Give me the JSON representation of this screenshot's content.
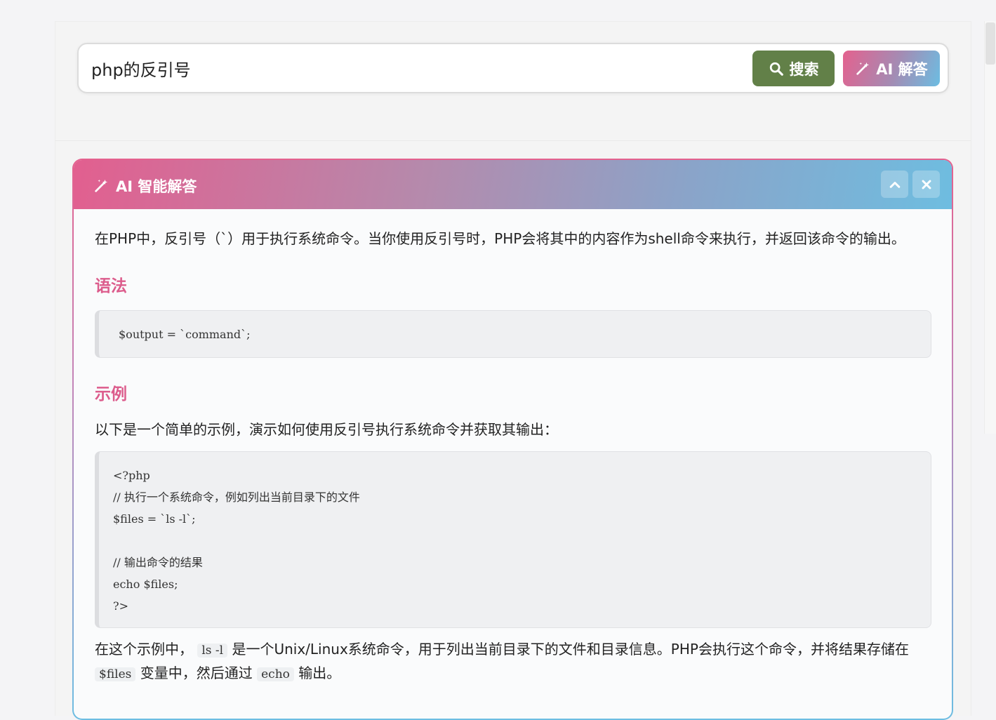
{
  "search": {
    "query": "php的反引号",
    "search_label": "搜索",
    "ai_label": "AI 解答"
  },
  "ai_panel": {
    "title": "AI 智能解答",
    "intro": "在PHP中，反引号（`）用于执行系统命令。当你使用反引号时，PHP会将其中的内容作为shell命令来执行，并返回该命令的输出。",
    "syntax_heading": "语法",
    "syntax_code": "$output = `command`;",
    "example_heading": "示例",
    "example_intro": "以下是一个简单的示例，演示如何使用反引号执行系统命令并获取其输出：",
    "example_code": "<?php\n// 执行一个系统命令，例如列出当前目录下的文件\n$files = `ls -l`;\n\n// 输出命令的结果\necho $files;\n?>",
    "explain_part1": "在这个示例中，",
    "explain_code1": "ls -l",
    "explain_part2": "是一个Unix/Linux系统命令，用于列出当前目录下的文件和目录信息。PHP会执行这个命令，并将结果存储在",
    "explain_code2": "$files",
    "explain_part3": "变量中，然后通过",
    "explain_code3": "echo",
    "explain_part4": "输出。"
  },
  "colors": {
    "search_button": "#628048",
    "accent_pink": "#dc5c8c",
    "accent_blue": "#6cbde2"
  },
  "icons": {
    "search": "search-icon",
    "ai": "magic-wand-icon",
    "collapse": "chevron-up-icon",
    "close": "close-icon"
  }
}
